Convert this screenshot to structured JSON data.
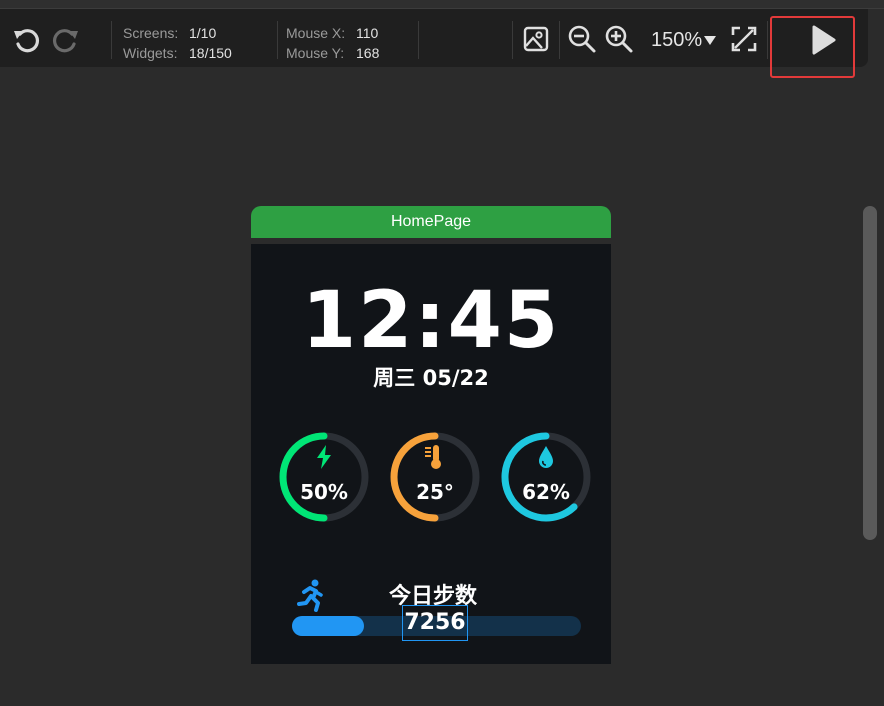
{
  "toolbar": {
    "undo_icon": "undo-icon",
    "redo_icon": "redo-icon",
    "screens_label": "Screens:",
    "screens_value": "1/10",
    "widgets_label": "Widgets:",
    "widgets_value": "18/150",
    "mouse_x_label": "Mouse X:",
    "mouse_x_value": "110",
    "mouse_y_label": "Mouse Y:",
    "mouse_y_value": "168",
    "zoom_value": "150%",
    "image_icon": "image-icon",
    "zoom_out_icon": "zoom-out-icon",
    "zoom_in_icon": "zoom-in-icon",
    "fit_icon": "fit-screen-icon",
    "play_icon": "play-icon"
  },
  "device": {
    "page_name": "HomePage",
    "time": "12:45",
    "date": "周三  05/22",
    "gauges": [
      {
        "icon": "battery-bolt-icon",
        "value": "50%",
        "fraction": 0.5,
        "color": "#00e676"
      },
      {
        "icon": "thermometer-icon",
        "value": "25°",
        "fraction": 0.5,
        "color": "#f7a23b"
      },
      {
        "icon": "water-drop-icon",
        "value": "62%",
        "fraction": 0.62,
        "color": "#1ec8e0"
      }
    ],
    "steps": {
      "icon": "running-icon",
      "title": "今日步数",
      "value": "7256",
      "fraction": 0.25
    }
  },
  "colors": {
    "accent_green": "#2ea043",
    "highlight_red": "#e23a3a",
    "progress_blue": "#2196f3"
  }
}
